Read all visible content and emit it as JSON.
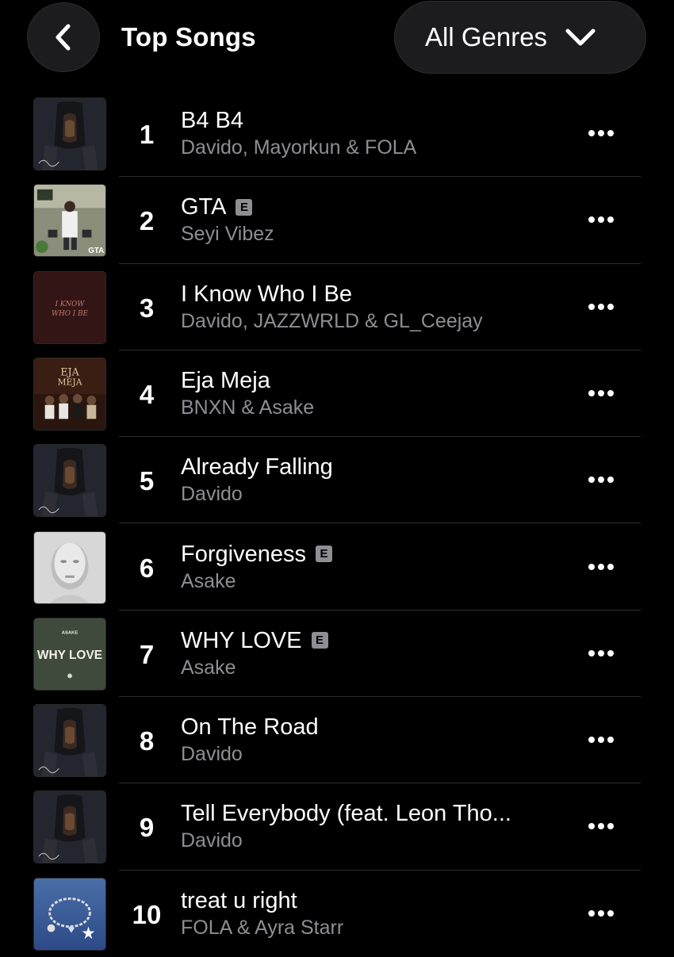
{
  "header": {
    "title": "Top Songs",
    "genre_label": "All Genres",
    "back_icon": "chevron-left-icon",
    "genre_icon": "chevron-down-icon"
  },
  "explicit_badge": "E",
  "songs": [
    {
      "rank": "1",
      "title": "B4 B4",
      "artist": "Davido, Mayorkun & FOLA",
      "explicit": false,
      "art": "davido-album"
    },
    {
      "rank": "2",
      "title": "GTA",
      "artist": "Seyi Vibez",
      "explicit": true,
      "art": "gta-cover",
      "art_text": "GTA"
    },
    {
      "rank": "3",
      "title": "I Know Who I Be",
      "artist": "Davido, JAZZWRLD & GL_Ceejay",
      "explicit": false,
      "art": "i-know-who-i-be-cover",
      "art_text": "I KNOW WHO I BE"
    },
    {
      "rank": "4",
      "title": "Eja Meja",
      "artist": "BNXN & Asake",
      "explicit": false,
      "art": "eja-meja-cover",
      "art_text": "EJA MEJA"
    },
    {
      "rank": "5",
      "title": "Already Falling",
      "artist": "Davido",
      "explicit": false,
      "art": "davido-album"
    },
    {
      "rank": "6",
      "title": "Forgiveness",
      "artist": "Asake",
      "explicit": true,
      "art": "asake-album"
    },
    {
      "rank": "7",
      "title": "WHY LOVE",
      "artist": "Asake",
      "explicit": true,
      "art": "why-love-cover",
      "art_text": "WHY LOVE",
      "art_subtext": "ASAKE"
    },
    {
      "rank": "8",
      "title": "On The Road",
      "artist": "Davido",
      "explicit": false,
      "art": "davido-album"
    },
    {
      "rank": "9",
      "title": "Tell Everybody (feat. Leon Tho...",
      "artist": "Davido",
      "explicit": false,
      "art": "davido-album"
    },
    {
      "rank": "10",
      "title": "treat u right",
      "artist": "FOLA & Ayra Starr",
      "explicit": false,
      "art": "treat-u-right-cover"
    }
  ],
  "colors": {
    "background": "#000000",
    "surface": "#1c1c1e",
    "secondary_text": "#8e8e93",
    "divider": "#2c2c2e"
  }
}
